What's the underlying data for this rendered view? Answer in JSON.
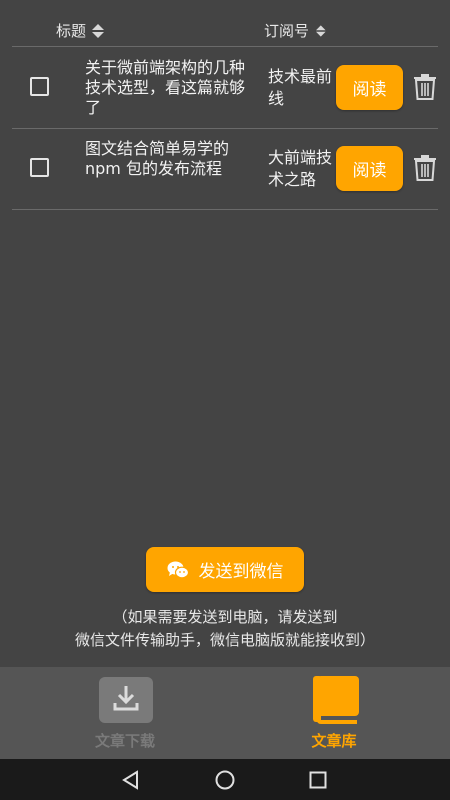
{
  "header": {
    "title_col": "标题",
    "sub_col": "订阅号"
  },
  "articles": [
    {
      "title": "关于微前端架构的几种技术选型，看这篇就够了",
      "account": "技术最前线",
      "action": "阅读"
    },
    {
      "title": "图文结合简单易学的 npm 包的发布流程",
      "account": "大前端技术之路",
      "action": "阅读"
    }
  ],
  "send": {
    "label": "发送到微信",
    "icon": "wechat-icon"
  },
  "note": {
    "line1": "（如果需要发送到电脑，请发送到",
    "line2": "微信文件传输助手，微信电脑版就能接收到）"
  },
  "tabs": [
    {
      "label": "文章下载",
      "icon": "download-icon",
      "active": false
    },
    {
      "label": "文章库",
      "icon": "book-icon",
      "active": true
    }
  ],
  "colors": {
    "accent": "#ffa500",
    "background": "#444444",
    "tabbar": "#555555",
    "inactive": "#7a7a7a"
  }
}
